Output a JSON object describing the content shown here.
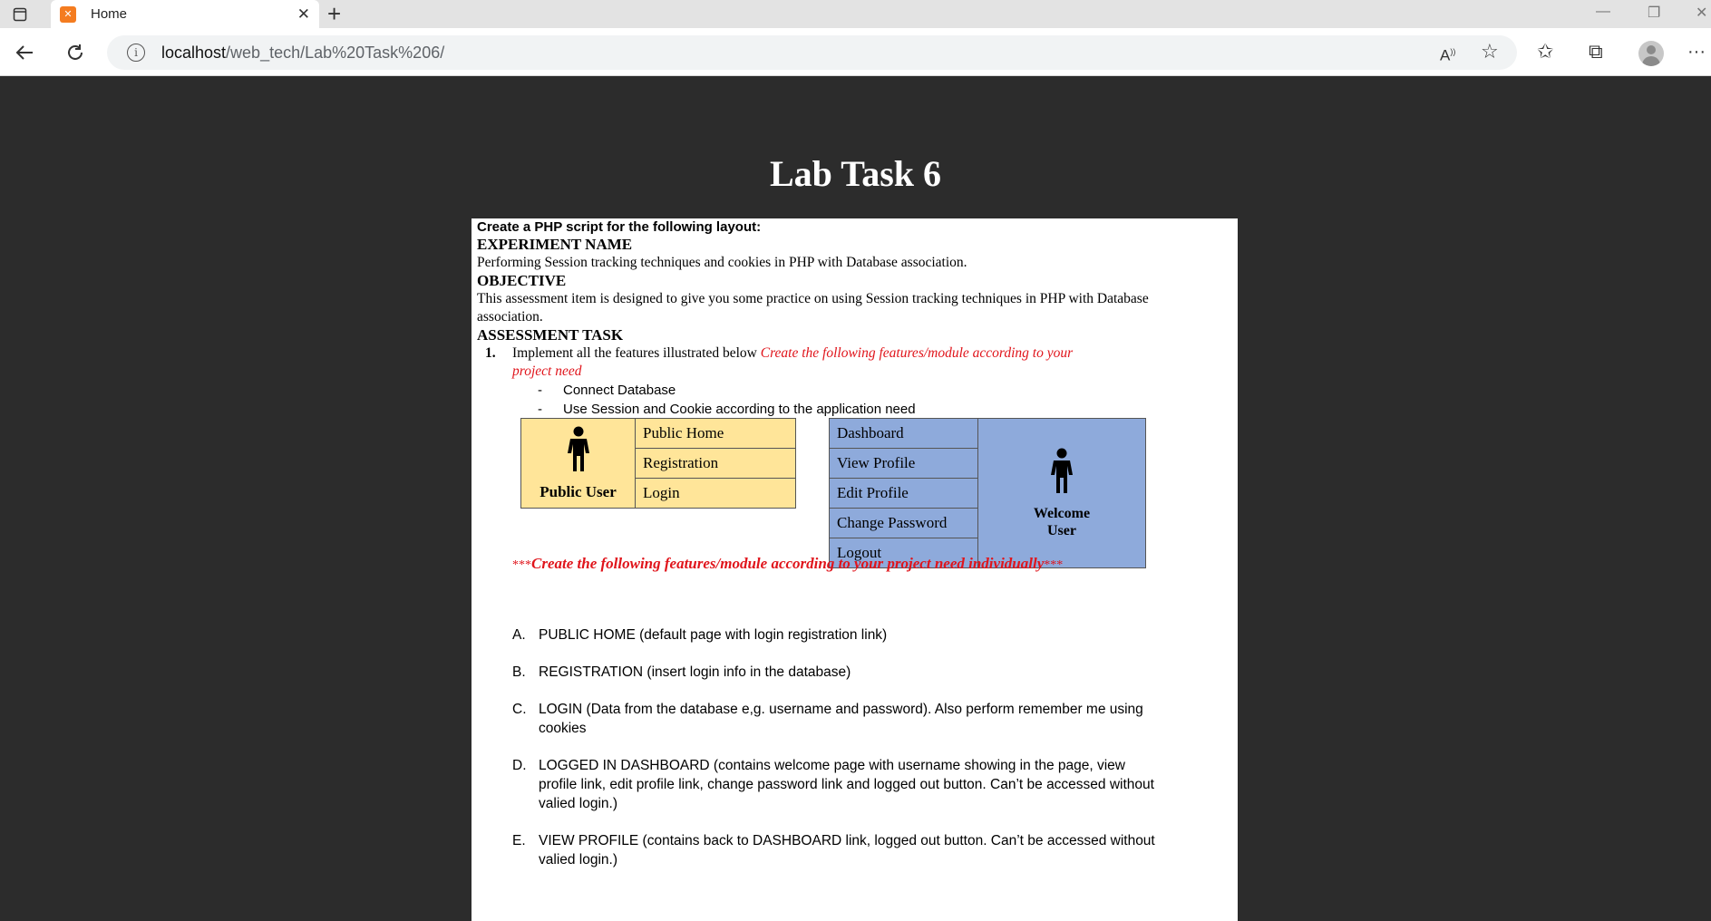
{
  "browser": {
    "tab_title": "Home",
    "url_host": "localhost",
    "url_path": "/web_tech/Lab%20Task%206/"
  },
  "page": {
    "title": "Lab Task 6"
  },
  "doc": {
    "intro": "Create a PHP script for the following layout:",
    "experiment_heading": "EXPERIMENT NAME",
    "experiment_text": "Performing Session tracking techniques and cookies in PHP with Database association.",
    "objective_heading": "OBJECTIVE",
    "objective_line1": "This assessment item is designed to give you some practice on using Session tracking techniques in PHP with Database",
    "objective_line2": "association.",
    "assessment_heading": "ASSESSMENT TASK",
    "task_number": "1.",
    "task_text": "Implement all the features illustrated below",
    "task_red_line1": "Create the following features/module according to your",
    "task_red_line2": "project need",
    "bullets": [
      "Connect Database",
      "Use Session and Cookie according to the application need"
    ],
    "public_table": {
      "user_label": "Public User",
      "items": [
        "Public Home",
        "Registration",
        "Login"
      ]
    },
    "welcome_table": {
      "user_label_line1": "Welcome",
      "user_label_line2": "User",
      "items": [
        "Dashboard",
        "View Profile",
        "Edit Profile",
        "Change Password",
        "Logout"
      ]
    },
    "red_note_stars": "***",
    "red_note_text": "Create the following features/module according to your project need individually",
    "requirements": [
      {
        "letter": "A.",
        "text": "PUBLIC HOME (default page with login registration link)"
      },
      {
        "letter": "B.",
        "text": "REGISTRATION (insert login info in the database)"
      },
      {
        "letter": "C.",
        "text": "LOGIN (Data from the database e,g. username and password). Also perform remember me using cookies"
      },
      {
        "letter": "D.",
        "text": "LOGGED IN DASHBOARD (contains welcome page with username showing in the page, view profile link, edit profile link, change password link and logged out button. Can’t be accessed without valied login.)"
      },
      {
        "letter": "E.",
        "text": "VIEW PROFILE (contains back to DASHBOARD link, logged out button. Can’t be accessed without valied login.)"
      }
    ]
  }
}
